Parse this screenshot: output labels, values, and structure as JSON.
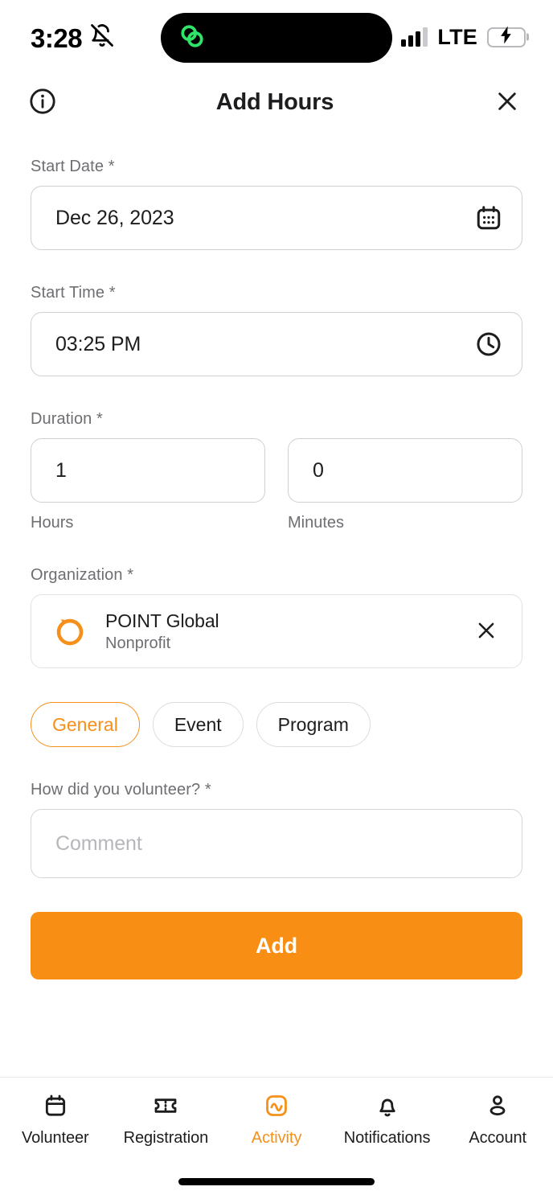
{
  "status_bar": {
    "time": "3:28",
    "silent_icon": "bell-slash-icon",
    "island_icon": "link-rings-icon",
    "island_icon_color": "#2ee56a",
    "network": "LTE",
    "signal_bars": 3,
    "signal_bars_total": 4,
    "battery_level_percent": 64,
    "battery_charging": true,
    "battery_color": "#30d158"
  },
  "header": {
    "info_icon": "info-circle-icon",
    "title": "Add Hours",
    "close_icon": "close-icon"
  },
  "form": {
    "start_date": {
      "label": "Start Date *",
      "value": "Dec 26, 2023",
      "icon": "calendar-icon"
    },
    "start_time": {
      "label": "Start Time *",
      "value": "03:25 PM",
      "icon": "clock-icon"
    },
    "duration": {
      "label": "Duration *",
      "hours_value": "1",
      "hours_caption": "Hours",
      "minutes_value": "0",
      "minutes_caption": "Minutes"
    },
    "organization": {
      "label": "Organization *",
      "name": "POINT Global",
      "type": "Nonprofit",
      "logo_icon": "point-ring-logo-icon",
      "logo_color": "#f5901a",
      "clear_icon": "close-icon"
    },
    "type_chips": [
      {
        "label": "General",
        "selected": true
      },
      {
        "label": "Event",
        "selected": false
      },
      {
        "label": "Program",
        "selected": false
      }
    ],
    "comment": {
      "label": "How did you volunteer? *",
      "value": "",
      "placeholder": "Comment"
    },
    "submit": {
      "label": "Add",
      "color": "#f88f14"
    }
  },
  "tabbar": {
    "accent_color": "#f5901a",
    "items": [
      {
        "label": "Volunteer",
        "icon": "calendar-icon",
        "active": false
      },
      {
        "label": "Registration",
        "icon": "ticket-icon",
        "active": false
      },
      {
        "label": "Activity",
        "icon": "activity-wave-icon",
        "active": true
      },
      {
        "label": "Notifications",
        "icon": "bell-icon",
        "active": false
      },
      {
        "label": "Account",
        "icon": "person-icon",
        "active": false
      }
    ]
  }
}
